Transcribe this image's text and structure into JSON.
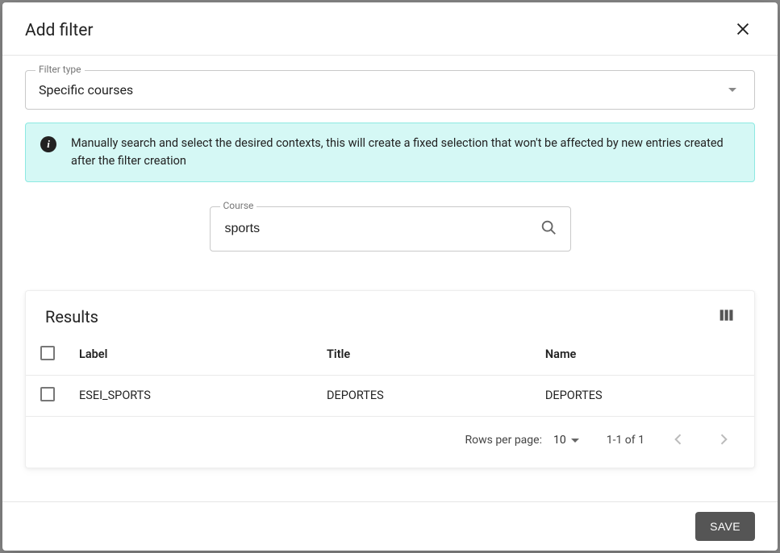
{
  "header": {
    "title": "Add filter"
  },
  "filterType": {
    "label": "Filter type",
    "value": "Specific courses"
  },
  "infoBanner": {
    "text": "Manually search and select the desired contexts, this will create a fixed selection that won't be affected by new entries created after the filter creation"
  },
  "courseSearch": {
    "label": "Course",
    "value": "sports"
  },
  "results": {
    "title": "Results",
    "columns": {
      "label": "Label",
      "title": "Title",
      "name": "Name"
    },
    "rows": [
      {
        "label": "ESEI_SPORTS",
        "title": "DEPORTES",
        "name": "DEPORTES"
      }
    ]
  },
  "pagination": {
    "rowsPerPageLabel": "Rows per page:",
    "rowsPerPage": "10",
    "range": "1-1 of 1"
  },
  "footer": {
    "save": "SAVE"
  }
}
